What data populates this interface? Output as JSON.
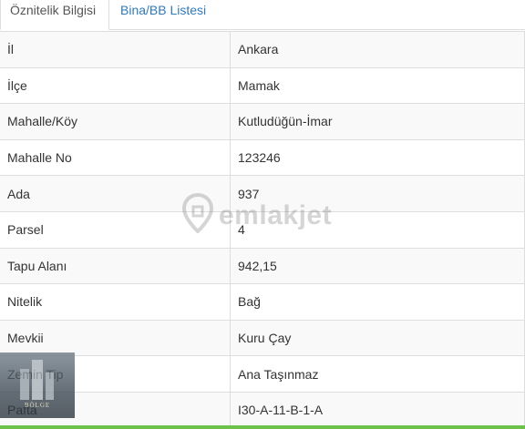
{
  "tabs": [
    {
      "label": "Öznitelik Bilgisi",
      "active": true
    },
    {
      "label": "Bina/BB Listesi",
      "active": false
    }
  ],
  "rows": [
    {
      "key": "İl",
      "value": "Ankara"
    },
    {
      "key": "İlçe",
      "value": "Mamak"
    },
    {
      "key": "Mahalle/Köy",
      "value": "Kutludüğün-İmar"
    },
    {
      "key": "Mahalle No",
      "value": "123246"
    },
    {
      "key": "Ada",
      "value": "937"
    },
    {
      "key": "Parsel",
      "value": "4"
    },
    {
      "key": "Tapu Alanı",
      "value": "942,15"
    },
    {
      "key": "Nitelik",
      "value": "Bağ"
    },
    {
      "key": "Mevkii",
      "value": "Kuru Çay"
    },
    {
      "key": "Zemin Tip",
      "value": "Ana Taşınmaz"
    },
    {
      "key": "Pafta",
      "value": "I30-A-11-B-1-A"
    }
  ],
  "watermark": {
    "text": "emlakjet",
    "icon": "location-pin-icon"
  },
  "logo": {
    "text": "BÖLGE"
  },
  "colors": {
    "link": "#337ab7",
    "border": "#dddddd",
    "stripe": "#f9f9f9",
    "bottom_bar": "#6cc24a"
  }
}
